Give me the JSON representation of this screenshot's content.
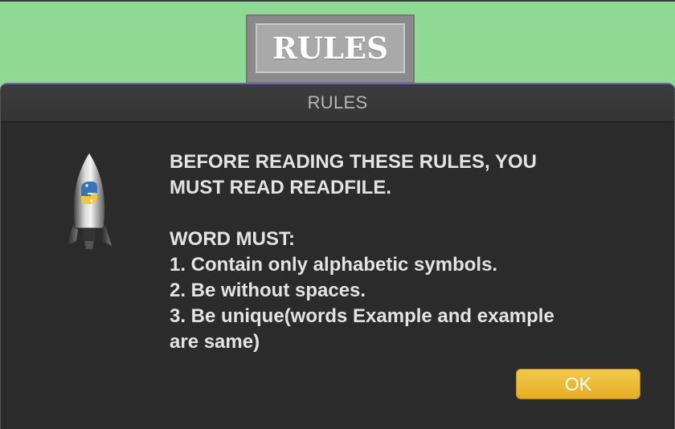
{
  "banner": {
    "title": "RULES"
  },
  "dialog": {
    "title": "RULES",
    "icon": "python-rocket-icon",
    "message": "BEFORE READING THESE RULES, YOU\nMUST READ READFILE.\n\nWORD MUST:\n1. Contain only alphabetic symbols.\n2. Be without spaces.\n3. Be unique(words Example and example\nare same)",
    "ok_label": "OK"
  },
  "colors": {
    "background": "#8fd994",
    "dialog": "#2b2b2b",
    "accent": "#e8b431"
  }
}
